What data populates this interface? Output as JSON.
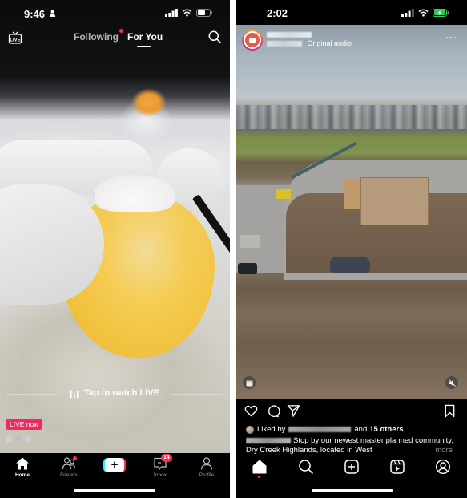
{
  "tiktok": {
    "status_bar": {
      "time": "9:46"
    },
    "top_bar": {
      "live_icon_label": "LIVE",
      "tabs": [
        {
          "label": "Following",
          "has_dot": true,
          "active": false
        },
        {
          "label": "For You",
          "active": true
        }
      ]
    },
    "overlay": {
      "tap_to_watch": "Tap to watch LIVE",
      "live_badge": "LIVE now",
      "username": "[blurred]"
    },
    "bottom_nav": [
      {
        "label": "Home",
        "icon": "home-icon",
        "active": true
      },
      {
        "label": "Friends",
        "icon": "friends-icon",
        "has_dot": true
      },
      {
        "label": "+",
        "icon": "create-icon"
      },
      {
        "label": "Inbox",
        "icon": "inbox-icon",
        "badge": "14"
      },
      {
        "label": "Profile",
        "icon": "profile-icon"
      }
    ],
    "colors": {
      "accent_pink": "#fe2c55",
      "accent_cyan": "#25f4ee",
      "live_badge": "#ea2c64"
    }
  },
  "instagram": {
    "status_bar": {
      "time": "2:02",
      "battery": "charging"
    },
    "post_header": {
      "username": "[blurred]",
      "handle": "[blurred]",
      "audio": "· Original audio",
      "more_label": "···"
    },
    "likes": {
      "prefix": "Liked by",
      "liker": "[blurred]",
      "and": "and",
      "others": "15 others"
    },
    "caption": {
      "user": "[blurred]",
      "text": "Stop by our newest master planned community, Dry Creek Highlands, located in West",
      "more": "more"
    },
    "bottom_nav": [
      {
        "icon": "home-icon",
        "active": true
      },
      {
        "icon": "search-icon"
      },
      {
        "icon": "create-icon"
      },
      {
        "icon": "reels-icon"
      },
      {
        "icon": "profile-icon"
      }
    ],
    "colors": {
      "battery_green": "#34c759",
      "notification_red": "#ff3040"
    }
  }
}
